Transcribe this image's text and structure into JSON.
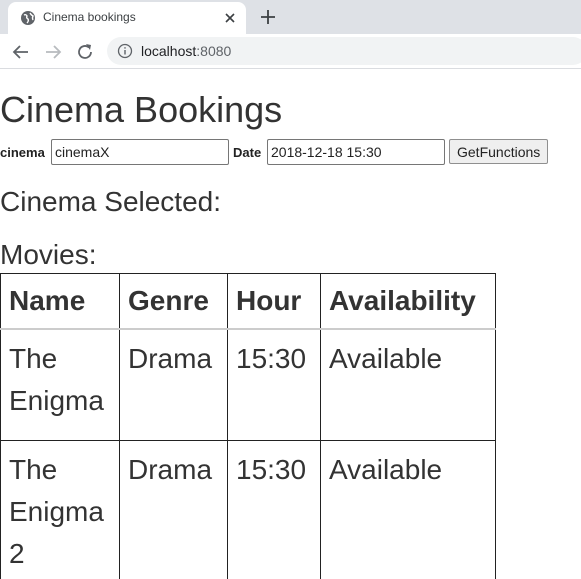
{
  "browser": {
    "tab_title": "Cinema bookings",
    "url_host": "localhost",
    "url_port": ":8080"
  },
  "page": {
    "title": "Cinema Bookings",
    "form": {
      "cinema_label": "cinema",
      "cinema_value": "cinemaX",
      "date_label": "Date",
      "date_value": "2018-12-18 15:30",
      "submit_label": "GetFunctions"
    },
    "cinema_selected_heading": "Cinema Selected:",
    "movies_heading": "Movies:",
    "table": {
      "headers": [
        "Name",
        "Genre",
        "Hour",
        "Availability"
      ],
      "rows": [
        [
          "The Enigma",
          "Drama",
          "15:30",
          "Available"
        ],
        [
          "The Enigma 2",
          "Drama",
          "15:30",
          "Available"
        ]
      ]
    }
  }
}
